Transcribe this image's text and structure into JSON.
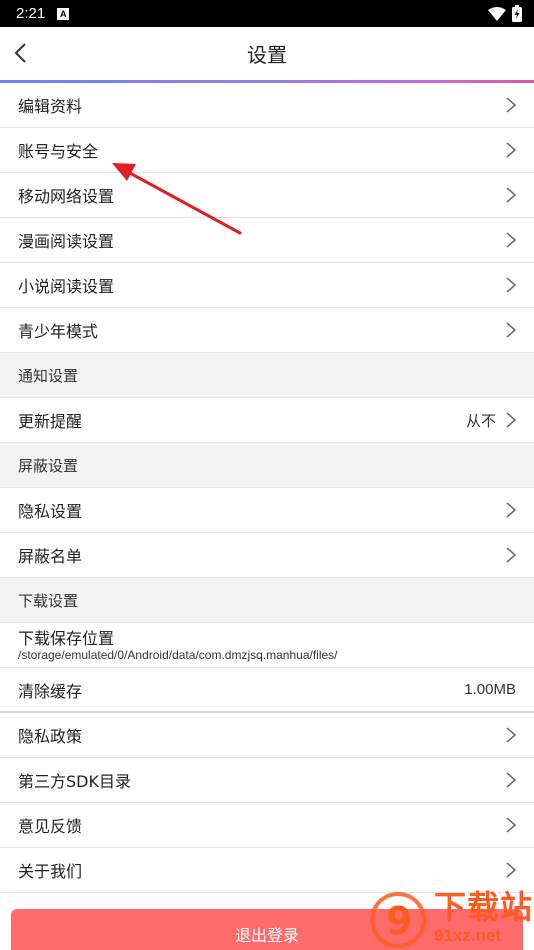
{
  "statusbar": {
    "time": "2:21",
    "notif_glyph": "A"
  },
  "header": {
    "title": "设置"
  },
  "rows": {
    "edit_profile": "编辑资料",
    "account_security": "账号与安全",
    "mobile_network": "移动网络设置",
    "comic_reading": "漫画阅读设置",
    "novel_reading": "小说阅读设置",
    "teen_mode": "青少年模式",
    "section_notify": "通知设置",
    "update_reminder": "更新提醒",
    "update_reminder_value": "从不",
    "section_block": "屏蔽设置",
    "privacy_settings": "隐私设置",
    "block_list": "屏蔽名单",
    "section_download": "下载设置",
    "download_location": "下载保存位置",
    "download_path": "/storage/emulated/0/Android/data/com.dmzjsq.manhua/files/",
    "clear_cache": "清除缓存",
    "cache_size": "1.00MB",
    "privacy_policy": "隐私政策",
    "third_party_sdk": "第三方SDK目录",
    "feedback": "意见反馈",
    "about_us": "关于我们"
  },
  "logout": {
    "label": "退出登录"
  },
  "watermark": {
    "logo_text": "下载站",
    "url": "91xz.net",
    "logo_glyph": "9"
  },
  "colors": {
    "accent": "#ff6b6b",
    "arrow": "#e02020",
    "watermark": "#ff5a1f"
  }
}
